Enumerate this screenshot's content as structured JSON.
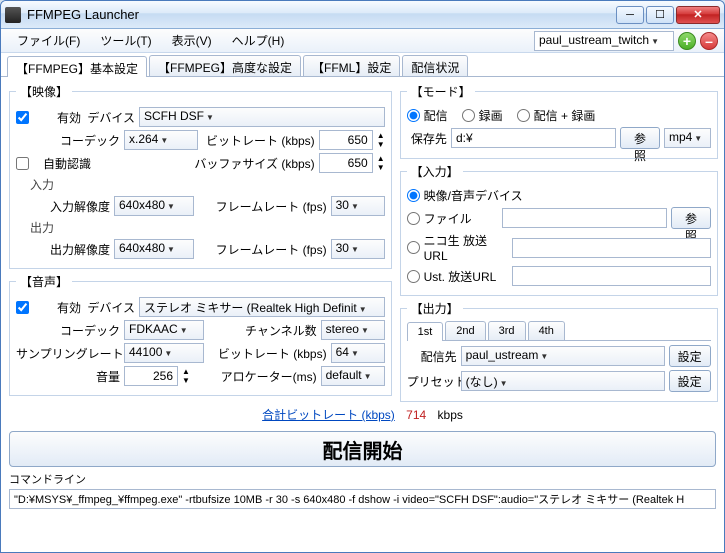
{
  "window": {
    "title": "FFMPEG Launcher"
  },
  "menu": {
    "file": "ファイル(F)",
    "tool": "ツール(T)",
    "view": "表示(V)",
    "help": "ヘルプ(H)",
    "profile": "paul_ustream_twitch"
  },
  "tabs": {
    "basic": "【FFMPEG】基本設定",
    "adv": "【FFMPEG】高度な設定",
    "ffml": "【FFML】設定",
    "status": "配信状況"
  },
  "video": {
    "legend": "【映像】",
    "enable": "有効",
    "device_label": "デバイス",
    "device": "SCFH DSF",
    "codec_label": "コーデック",
    "codec": "x.264",
    "bitrate_label": "ビットレート (kbps)",
    "bitrate": "650",
    "auto_label": "自動認識",
    "bufsize_label": "バッファサイズ (kbps)",
    "bufsize": "650",
    "input_sub": "入力",
    "in_res_label": "入力解像度",
    "in_res": "640x480",
    "in_fps_label": "フレームレート (fps)",
    "in_fps": "30",
    "output_sub": "出力",
    "out_res_label": "出力解像度",
    "out_res": "640x480",
    "out_fps_label": "フレームレート (fps)",
    "out_fps": "30"
  },
  "audio": {
    "legend": "【音声】",
    "enable": "有効",
    "device_label": "デバイス",
    "device": "ステレオ ミキサー (Realtek High Definit",
    "codec_label": "コーデック",
    "codec": "FDKAAC",
    "channels_label": "チャンネル数",
    "channels": "stereo",
    "sr_label": "サンプリングレート(Hz)",
    "sr": "44100",
    "bitrate_label": "ビットレート (kbps)",
    "bitrate": "64",
    "vol_label": "音量",
    "vol": "256",
    "alloc_label": "アロケーター(ms)",
    "alloc": "default"
  },
  "mode": {
    "legend": "【モード】",
    "stream": "配信",
    "rec": "録画",
    "both": "配信 + 録画",
    "save_label": "保存先",
    "save_path": "d:¥",
    "browse": "参照",
    "format": "mp4"
  },
  "input": {
    "legend": "【入力】",
    "dev": "映像/音声デバイス",
    "file": "ファイル",
    "browse": "参照",
    "nico": "ニコ生 放送URL",
    "ust": "Ust. 放送URL"
  },
  "output": {
    "legend": "【出力】",
    "tabs": [
      "1st",
      "2nd",
      "3rd",
      "4th"
    ],
    "dest_label": "配信先",
    "dest": "paul_ustream",
    "set": "設定",
    "preset_label": "プリセット",
    "preset": "(なし)"
  },
  "total": {
    "label": "合計ビットレート (kbps)",
    "value": "714",
    "unit": "kbps"
  },
  "start_btn": "配信開始",
  "cmd": {
    "label": "コマンドライン",
    "value": "\"D:¥MSYS¥_ffmpeg_¥ffmpeg.exe\" -rtbufsize 10MB -r 30 -s 640x480 -f dshow -i video=\"SCFH DSF\":audio=\"ステレオ ミキサー (Realtek H"
  }
}
